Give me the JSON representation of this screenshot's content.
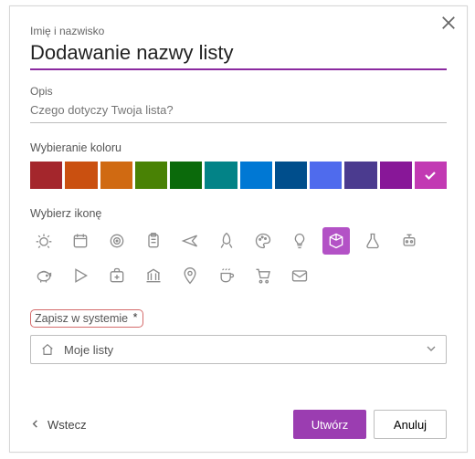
{
  "labels": {
    "name_label": "Imię i nazwisko",
    "title_value": "Dodawanie nazwy listy",
    "desc_label": "Opis",
    "desc_placeholder": "Czego dotyczy Twoja lista?",
    "color_label": "Wybieranie koloru",
    "icon_label": "Wybierz ikonę",
    "save_label": "Zapisz w systemie",
    "required_mark": "*",
    "save_location": "Moje listy",
    "back_label": "Wstecz",
    "create_label": "Utwórz",
    "cancel_label": "Anuluj"
  },
  "colors": [
    "#a4262c",
    "#ca5010",
    "#d06a12",
    "#498205",
    "#0b6a0b",
    "#038387",
    "#0078d4",
    "#004e8c",
    "#4f6bed",
    "#4b3b8f",
    "#881798",
    "#c239b3"
  ],
  "selected_color_index": 11,
  "icons": [
    "bug",
    "calendar",
    "target",
    "clipboard",
    "airplane",
    "rocket",
    "palette",
    "lightbulb",
    "cube",
    "flask",
    "robot",
    "piggybank",
    "play",
    "firstaid",
    "bank",
    "location",
    "coffee",
    "cart",
    "mail"
  ],
  "selected_icon_index": 8
}
